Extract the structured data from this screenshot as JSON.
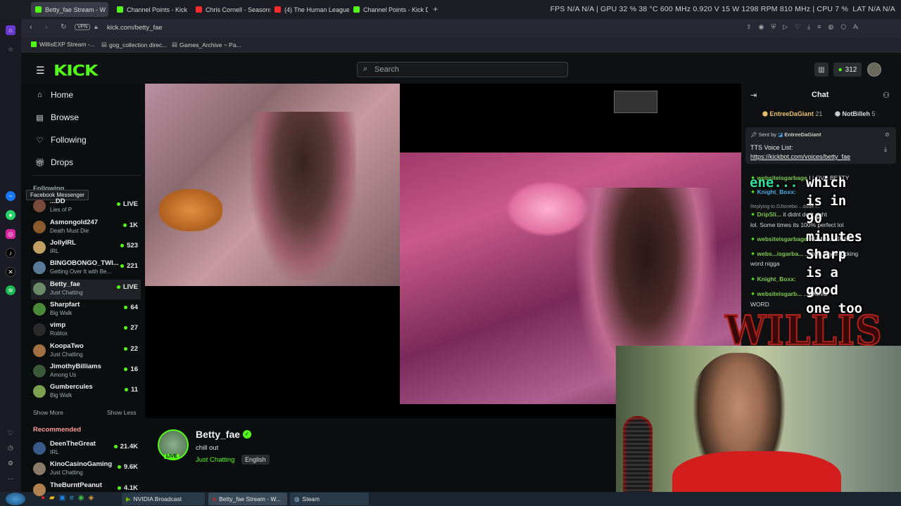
{
  "browser": {
    "tabs": [
      {
        "label": "Betty_fae Stream - W",
        "color": "#53fc18"
      },
      {
        "label": "Channel Points - Kick Das",
        "color": "#53fc18"
      },
      {
        "label": "Chris Cornell - Seasons (w",
        "color": "#ff2a2a"
      },
      {
        "label": "(4) The Human League - D",
        "color": "#ff2a2a"
      },
      {
        "label": "Channel Points - Kick Das",
        "color": "#53fc18"
      }
    ],
    "new_tab": "+",
    "perf": "FPS  N/A  N/A  |  GPU  32 %  38 °C  600 MHz  0.920 V  15 W  1298 RPM  810 MHz  |  CPU  7 %",
    "perf_right": "LAT  N/A  N/A",
    "vpn": "VPN",
    "url": "kick.com/betty_fae",
    "bookmarks": [
      "WillisEXP Stream -...",
      "gog_collection direc...",
      "Games_Archive ~ Pa..."
    ],
    "tooltip": "Facebook Messenger"
  },
  "header": {
    "logo": "KICK",
    "search_placeholder": "Search",
    "points": "312"
  },
  "nav": {
    "home": "Home",
    "browse": "Browse",
    "following": "Following",
    "drops": "Drops",
    "following_heading": "Following",
    "show_more": "Show More",
    "show_less": "Show Less",
    "recommended_heading": "Recommended"
  },
  "following_channels": [
    {
      "name": "...DD",
      "sub": "Lies of P",
      "viewers": "LIVE",
      "color": "#7a4b3a"
    },
    {
      "name": "Asmongold247",
      "sub": "Death Must Die",
      "viewers": "1K",
      "color": "#8a5a2a"
    },
    {
      "name": "JollyIRL",
      "sub": "IRL",
      "viewers": "523",
      "color": "#c0a060"
    },
    {
      "name": "BINGOBONGO_TWI...",
      "sub": "Getting Over It with Be...",
      "viewers": "221",
      "color": "#5a7a9a"
    },
    {
      "name": "Betty_fae",
      "sub": "Just Chatting",
      "viewers": "LIVE",
      "color": "#6a8a6a"
    },
    {
      "name": "Sharpfart",
      "sub": "Big Walk",
      "viewers": "64",
      "color": "#4a8a3a"
    },
    {
      "name": "vimp",
      "sub": "Roblox",
      "viewers": "27",
      "color": "#2a2a2a"
    },
    {
      "name": "KoopaTwo",
      "sub": "Just Chatting",
      "viewers": "22",
      "color": "#a07040"
    },
    {
      "name": "JimothyBilliams",
      "sub": "Among Us",
      "viewers": "16",
      "color": "#3a5a3a"
    },
    {
      "name": "Gumbercules",
      "sub": "Big Walk",
      "viewers": "11",
      "color": "#7aa050"
    }
  ],
  "recommended_channels": [
    {
      "name": "DeenTheGreat",
      "sub": "IRL",
      "viewers": "21.4K",
      "color": "#3a5a8a"
    },
    {
      "name": "KinoCasinoGaming",
      "sub": "Just Chatting",
      "viewers": "9.6K",
      "color": "#8a7a6a"
    },
    {
      "name": "TheBurntPeanut",
      "sub": "",
      "viewers": "4.1K",
      "color": "#b08050"
    }
  ],
  "stream_info": {
    "name": "Betty_fae",
    "title": "chill out",
    "category": "Just Chatting",
    "tag": "English",
    "live_badge": "LIVE"
  },
  "chat": {
    "title": "Chat",
    "gifter1": "EntreeDaGiant",
    "gifter1_count": "21",
    "gifter2": "NotBilleh",
    "gifter2_count": "5",
    "pinned_sent_by": "Sent by",
    "pinned_user": "EntreeDaGiant",
    "pinned_text": "TTS Voice List:",
    "pinned_link": "https://kickbot.com/voices/betty_fae",
    "messages": [
      {
        "user": "websiteisgarbage",
        "text": "I LOVE BETTY"
      },
      {
        "user": "Knight_Boxx:",
        "text": ""
      },
      {
        "user": "",
        "text": "Replying to DJtonebo  ...dude i..."
      },
      {
        "user": "DripSli...",
        "text": "it didnt do it right"
      },
      {
        "user": "",
        "text": "lol. Some times its 100% perfect lol"
      },
      {
        "user": "websiteisgarbage",
        "text": "HUMBA...SIMP"
      },
      {
        "user": "webs...isgarba...",
        "text": "...then say a fucking"
      },
      {
        "user": "",
        "text": "word nigga"
      },
      {
        "user": "Knight_Boxx:",
        "text": ""
      },
      {
        "user": "websiteisgarb...",
        "text": "...CKING"
      },
      {
        "user": "",
        "text": "WORD"
      }
    ],
    "overlay_lines": [
      "ene...",
      "which",
      "is in",
      "90",
      "minutes",
      "Sharp",
      "is a",
      "good",
      "one too"
    ],
    "willis": "WILLIS"
  },
  "taskbar": {
    "items": [
      "NVIDIA Broadcast",
      "Betty_fae Stream - W...",
      "Steam"
    ]
  }
}
